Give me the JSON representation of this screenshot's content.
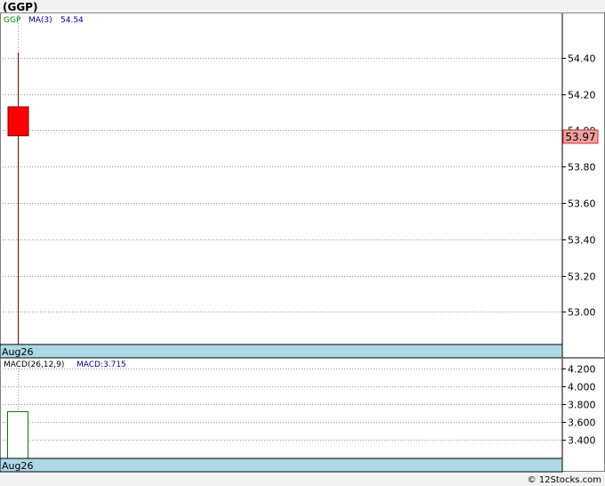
{
  "title": "(GGP)",
  "footer": "© 12Stocks.com",
  "colors": {
    "background": "#ffffff",
    "page_bg": "#f2f2f2",
    "grid": "#9a9a9a",
    "axis_strip": "#add8e6",
    "candle_down": "#ff0000",
    "wick": "#800000",
    "macd_bar": "#008000",
    "price_label_bg": "#f4a0a0",
    "legend_ticker": "#008000",
    "legend_ma": "#000099",
    "legend_macd": "#000099"
  },
  "chart_data": [
    {
      "type": "candlestick",
      "legend": {
        "ticker": "GGP",
        "ma_label": "MA(3)",
        "ma_value": "54.54"
      },
      "categories": [
        "Aug26"
      ],
      "candles": [
        {
          "date": "Aug26",
          "open": 54.13,
          "high": 54.43,
          "low": 52.82,
          "close": 53.97
        }
      ],
      "last_price": "53.97",
      "ylim": [
        52.82,
        54.65
      ],
      "yticks": [
        53.0,
        53.2,
        53.4,
        53.6,
        53.8,
        54.0,
        54.2,
        54.4
      ],
      "ytick_labels": [
        "53.00",
        "53.20",
        "53.40",
        "53.60",
        "53.80",
        "54.00",
        "54.20",
        "54.40"
      ],
      "grid": true
    },
    {
      "type": "bar",
      "legend": {
        "params": "MACD(26,12,9)",
        "value_label": "MACD:3.715"
      },
      "categories": [
        "Aug26"
      ],
      "values": [
        3.715
      ],
      "ylim": [
        3.19,
        4.32
      ],
      "yticks": [
        3.4,
        3.6,
        3.8,
        4.0,
        4.2
      ],
      "ytick_labels": [
        "3.400",
        "3.600",
        "3.800",
        "4.000",
        "4.200"
      ],
      "grid": true
    }
  ]
}
